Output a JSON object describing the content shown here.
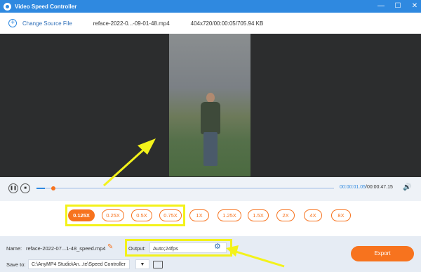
{
  "app": {
    "title": "Video Speed Controller",
    "accent": "#2f89e0",
    "orange": "#f7731e"
  },
  "window_controls": {
    "minimize": "—",
    "restore": "☐",
    "close": "✕"
  },
  "toolbar": {
    "change_source_label": "Change Source File",
    "file_name": "reface-2022-0...-09-01-48.mp4",
    "file_info": "404x720/00:00:05/705.94 KB"
  },
  "playback": {
    "current_time": "00:00:01.05",
    "separator": "/",
    "total_time": "00:00:47.15",
    "progress_fraction": 0.028,
    "pause_icon": "❚❚",
    "stop_icon": "■",
    "volume_icon": "🔊"
  },
  "speeds": {
    "options": [
      "0.125X",
      "0.25X",
      "0.5X",
      "0.75X",
      "1X",
      "1.25X",
      "1.5X",
      "2X",
      "4X",
      "8X"
    ],
    "selected": "0.125X"
  },
  "bottom": {
    "name_label": "Name:",
    "name_value": "reface-2022-07...1-48_speed.mp4",
    "output_label": "Output:",
    "output_value": "Auto;24fps",
    "saveto_label": "Save to:",
    "saveto_value": "C:\\AnyMP4 Studio\\An...te\\Speed Controller",
    "dropdown_glyph": "▼",
    "export_label": "Export"
  },
  "icons": [
    "app-logo-icon",
    "add-icon",
    "pause-icon",
    "stop-icon",
    "volume-icon",
    "edit-icon",
    "gear-icon",
    "folder-icon"
  ]
}
